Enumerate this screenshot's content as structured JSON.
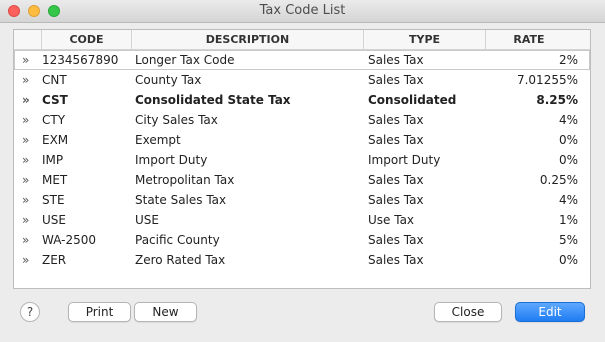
{
  "window": {
    "title": "Tax Code List"
  },
  "table": {
    "headers": {
      "code": "CODE",
      "description": "DESCRIPTION",
      "type": "TYPE",
      "rate": "RATE"
    },
    "rows": [
      {
        "code": "1234567890",
        "description": "Longer Tax Code",
        "type": "Sales Tax",
        "rate": "2%"
      },
      {
        "code": "CNT",
        "description": "County Tax",
        "type": "Sales Tax",
        "rate": "7.01255%"
      },
      {
        "code": "CST",
        "description": "Consolidated State Tax",
        "type": "Consolidated",
        "rate": "8.25%"
      },
      {
        "code": "CTY",
        "description": "City Sales Tax",
        "type": "Sales Tax",
        "rate": "4%"
      },
      {
        "code": "EXM",
        "description": "Exempt",
        "type": "Sales Tax",
        "rate": "0%"
      },
      {
        "code": "IMP",
        "description": "Import Duty",
        "type": "Import Duty",
        "rate": "0%"
      },
      {
        "code": "MET",
        "description": "Metropolitan Tax",
        "type": "Sales Tax",
        "rate": "0.25%"
      },
      {
        "code": "STE",
        "description": "State Sales Tax",
        "type": "Sales Tax",
        "rate": "4%"
      },
      {
        "code": "USE",
        "description": "USE",
        "type": "Use Tax",
        "rate": "1%"
      },
      {
        "code": "WA-2500",
        "description": "Pacific County",
        "type": "Sales Tax",
        "rate": "5%"
      },
      {
        "code": "ZER",
        "description": "Zero Rated Tax",
        "type": "Sales Tax",
        "rate": "0%"
      }
    ]
  },
  "buttons": {
    "help": "?",
    "print": "Print",
    "new": "New",
    "close": "Close",
    "edit": "Edit"
  },
  "icons": {
    "row_chevron": "double-chevron-right-icon"
  },
  "colors": {
    "accent": "#1f7cf2"
  }
}
